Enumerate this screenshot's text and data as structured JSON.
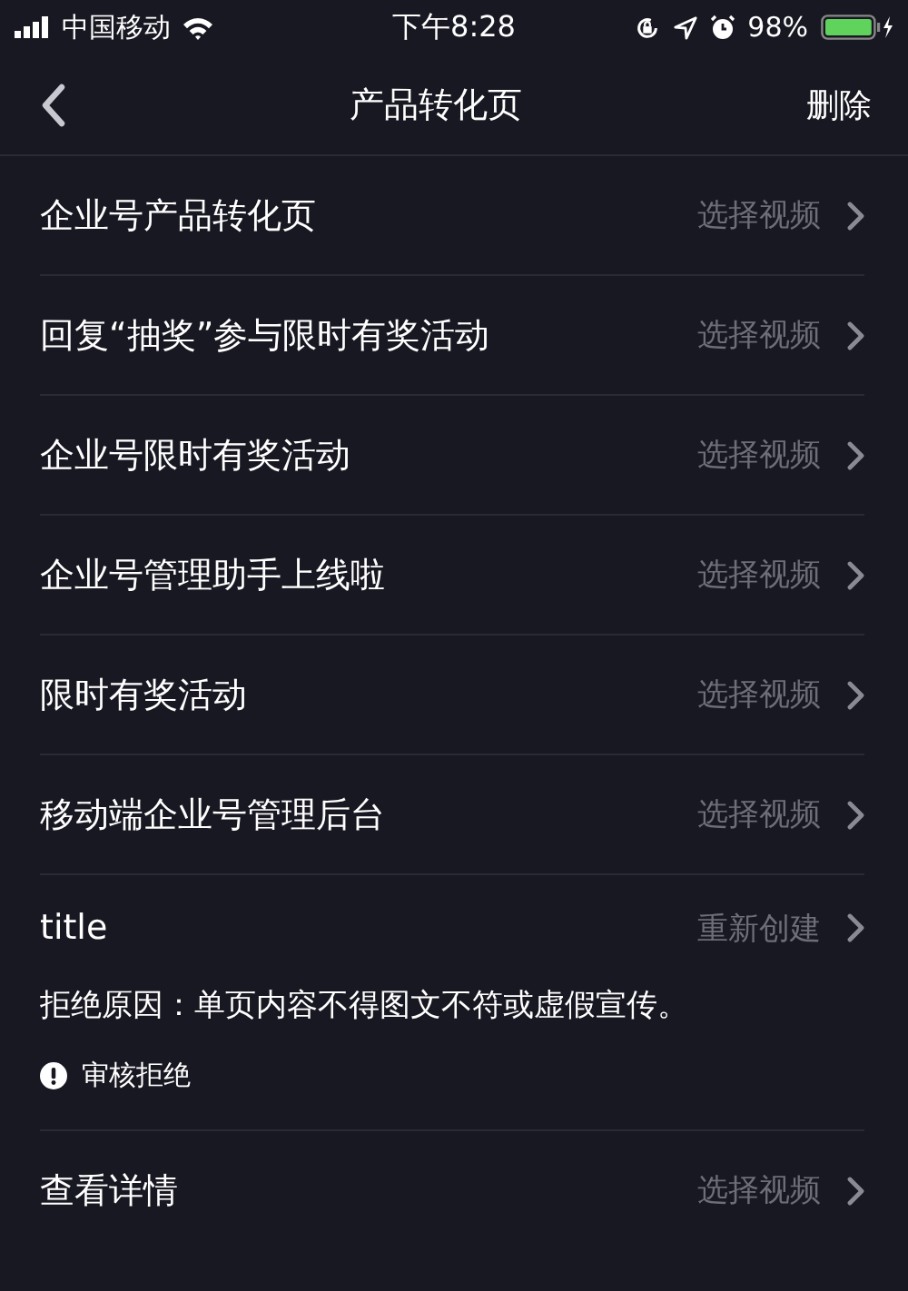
{
  "status_bar": {
    "carrier": "中国移动",
    "time": "下午8:28",
    "battery": "98%"
  },
  "nav": {
    "title": "产品转化页",
    "action": "删除"
  },
  "items": [
    {
      "kind": "link",
      "label": "企业号产品转化页",
      "action": "选择视频"
    },
    {
      "kind": "link",
      "label": "回复“抽奖”参与限时有奖活动",
      "action": "选择视频"
    },
    {
      "kind": "link",
      "label": "企业号限时有奖活动",
      "action": "选择视频"
    },
    {
      "kind": "link",
      "label": "企业号管理助手上线啦",
      "action": "选择视频"
    },
    {
      "kind": "link",
      "label": "限时有奖活动",
      "action": "选择视频"
    },
    {
      "kind": "link",
      "label": "移动端企业号管理后台",
      "action": "选择视频"
    },
    {
      "kind": "review",
      "label": "title",
      "action": "重新创建",
      "reason": "拒绝原因：单页内容不得图文不符或虚假宣传。",
      "status": "审核拒绝"
    },
    {
      "kind": "link",
      "label": "查看详情",
      "action": "选择视频"
    }
  ]
}
